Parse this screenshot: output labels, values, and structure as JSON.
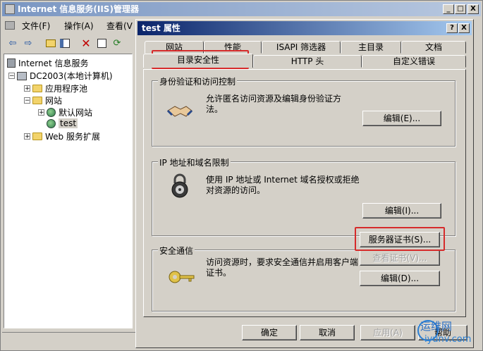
{
  "main_window": {
    "title": "Internet 信息服务(IIS)管理器",
    "controls": {
      "minimize": "_",
      "restore": "□",
      "close": "X"
    }
  },
  "menu": {
    "file": "文件(F)",
    "action": "操作(A)",
    "view": "查看(V"
  },
  "toolbar_icons": [
    "back-arrow-icon",
    "forward-arrow-icon",
    "up-folder-icon",
    "show-tree-icon",
    "delete-icon",
    "properties-icon",
    "refresh-icon"
  ],
  "tree": {
    "root": "Internet 信息服务",
    "computer": "DC2003(本地计算机)",
    "app_pools": "应用程序池",
    "websites": "网站",
    "default_site": "默认网站",
    "test_site": "test",
    "web_ext": "Web 服务扩展"
  },
  "dialog": {
    "title": "test 属性",
    "help_btn": "?",
    "close_btn": "X",
    "tabs_row1": [
      "网站",
      "性能",
      "ISAPI 筛选器",
      "主目录",
      "文档"
    ],
    "tabs_row2": [
      "目录安全性",
      "HTTP 头",
      "自定义错误"
    ],
    "active_tab": "目录安全性",
    "auth": {
      "label": "身份验证和访问控制",
      "text": "允许匿名访问资源及编辑身份验证方法。",
      "edit_btn": "编辑(E)..."
    },
    "ip": {
      "label": "IP 地址和域名限制",
      "text": "使用 IP 地址或 Internet 域名授权或拒绝对资源的访问。",
      "edit_btn": "编辑(I)..."
    },
    "secure": {
      "label": "安全通信",
      "text": "访问资源时，要求安全通信并启用客户端证书。",
      "server_cert_btn": "服务器证书(S)...",
      "view_cert_btn": "查看证书(V)...",
      "edit_btn": "编辑(D)..."
    },
    "ok_btn": "确定",
    "cancel_btn": "取消",
    "apply_btn": "应用(A)",
    "help_bottom_btn": "帮助"
  },
  "watermark": {
    "line1": "运维网",
    "line2": "iyunv.com"
  },
  "highlight_color": "#d62b2b"
}
